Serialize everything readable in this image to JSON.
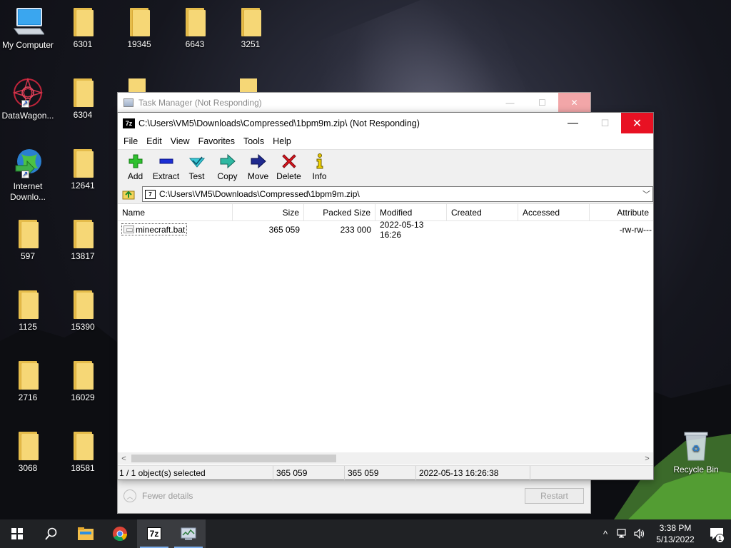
{
  "desktop": {
    "icons": [
      {
        "label": "My Computer"
      },
      {
        "label": "DataWagon..."
      },
      {
        "label": "Internet\nDownlo..."
      },
      {
        "label": "597"
      },
      {
        "label": "1125"
      },
      {
        "label": "2716"
      },
      {
        "label": "3068"
      },
      {
        "label": "6301"
      },
      {
        "label": "6304"
      },
      {
        "label": "12641"
      },
      {
        "label": "13817"
      },
      {
        "label": "15390"
      },
      {
        "label": "16029"
      },
      {
        "label": "18581"
      },
      {
        "label": "19345"
      },
      {
        "label": "6643"
      },
      {
        "label": "3251"
      },
      {
        "label": "Recycle Bin"
      }
    ]
  },
  "task_manager": {
    "title": "Task Manager (Not Responding)",
    "fewer_details": "Fewer details",
    "restart": "Restart"
  },
  "sevenzip": {
    "title": "C:\\Users\\VM5\\Downloads\\Compressed\\1bpm9m.zip\\ (Not Responding)",
    "menu": [
      "File",
      "Edit",
      "View",
      "Favorites",
      "Tools",
      "Help"
    ],
    "toolbar": [
      "Add",
      "Extract",
      "Test",
      "Copy",
      "Move",
      "Delete",
      "Info"
    ],
    "address": "C:\\Users\\VM5\\Downloads\\Compressed\\1bpm9m.zip\\",
    "columns": [
      "Name",
      "Size",
      "Packed Size",
      "Modified",
      "Created",
      "Accessed",
      "Attribute"
    ],
    "rows": [
      {
        "name": "minecraft.bat",
        "size": "365 059",
        "packed": "233 000",
        "modified": "2022-05-13 16:26",
        "created": "",
        "accessed": "",
        "attributes": "-rw-rw---"
      }
    ],
    "status": {
      "selected": "1 / 1 object(s) selected",
      "size": "365 059",
      "packed": "365 059",
      "modified": "2022-05-13 16:26:38"
    }
  },
  "taskbar": {
    "time": "3:38 PM",
    "date": "5/13/2022",
    "notification_count": "1",
    "sevenzip_label": "7z"
  },
  "colors": {
    "close_red": "#e81123",
    "taskbar": "#202225",
    "folder": "#f6d776"
  }
}
